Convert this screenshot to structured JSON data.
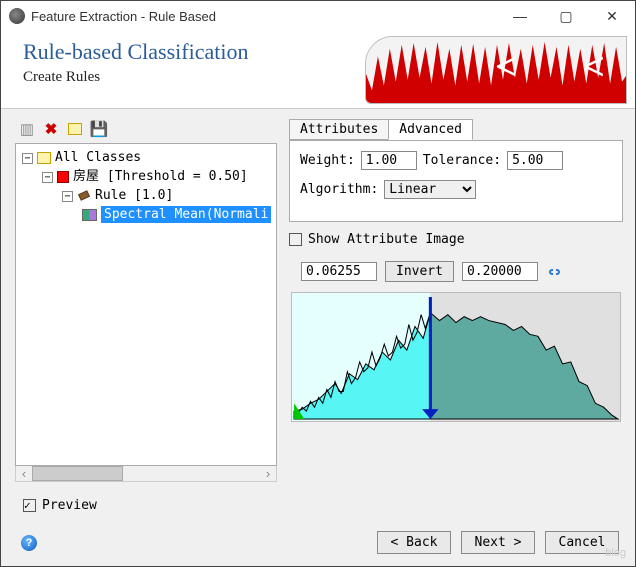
{
  "window": {
    "title": "Feature Extraction - Rule Based"
  },
  "banner": {
    "title": "Rule-based Classification",
    "subtitle": "Create Rules"
  },
  "tree": {
    "root": "All Classes",
    "class_label": "房屋 [Threshold = 0.50]",
    "rule_label": "Rule [1.0]",
    "attr_label": "Spectral Mean(Normali"
  },
  "tabs": {
    "attributes": "Attributes",
    "advanced": "Advanced"
  },
  "advanced": {
    "weight_label": "Weight:",
    "weight_value": "1.00",
    "tolerance_label": "Tolerance:",
    "tolerance_value": "5.00",
    "algo_label": "Algorithm:",
    "algo_value": "Linear"
  },
  "show_attr_image": "Show Attribute Image",
  "range": {
    "min": "0.06255",
    "invert": "Invert",
    "max": "0.20000"
  },
  "chart_data": {
    "type": "area",
    "title": "",
    "xlabel": "",
    "ylabel": "",
    "xlim": [
      0.0,
      1.0
    ],
    "ylim": [
      0,
      1
    ],
    "selection": [
      0.06255,
      0.2
    ],
    "note": "histogram silhouette, relative heights only (no axis labels shown)",
    "x": [
      0.0,
      0.05,
      0.1,
      0.15,
      0.2,
      0.25,
      0.3,
      0.35,
      0.4,
      0.45,
      0.5,
      0.55,
      0.6,
      0.65,
      0.7,
      0.75,
      0.8,
      0.85,
      0.9,
      0.95,
      1.0
    ],
    "values": [
      0.05,
      0.08,
      0.12,
      0.18,
      0.22,
      0.3,
      0.4,
      0.55,
      0.62,
      0.8,
      0.95,
      0.85,
      0.82,
      0.8,
      0.78,
      0.72,
      0.62,
      0.45,
      0.25,
      0.08,
      0.02
    ]
  },
  "preview_label": "Preview",
  "buttons": {
    "back": "< Back",
    "next": "Next >",
    "cancel": "Cancel"
  },
  "watermark": "blog"
}
